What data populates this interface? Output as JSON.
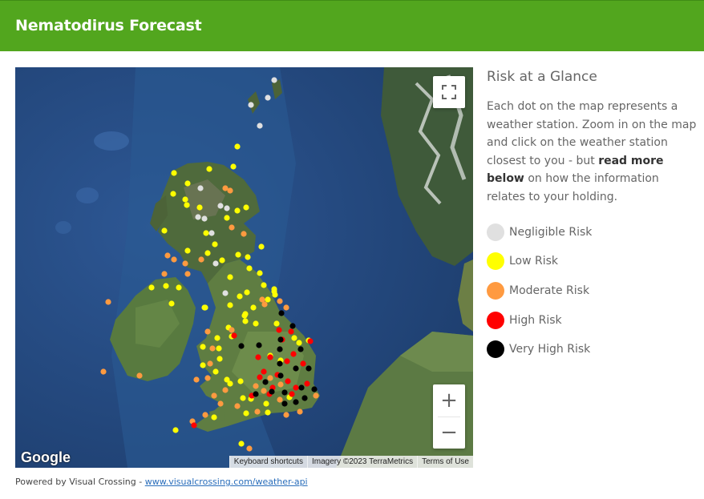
{
  "header": {
    "title": "Nematodirus Forecast"
  },
  "map": {
    "fullscreen_icon": "fullscreen-icon",
    "zoom_in_label": "+",
    "zoom_out_label": "−",
    "logo_text": "Google",
    "attribution": {
      "shortcuts": "Keyboard shortcuts",
      "imagery": "Imagery ©2023 TerraMetrics",
      "terms": "Terms of Use"
    },
    "colors": {
      "negligible": "#e0e0e0",
      "low": "#ffff00",
      "moderate": "#ff9a40",
      "high": "#ff0000",
      "very_high": "#000000"
    }
  },
  "sidebar": {
    "title": "Risk at a Glance",
    "description_before": "Each dot on the map represents a weather station. Zoom in on the map and click on the weather station closest to you - but ",
    "description_bold": "read more below",
    "description_after": " on how the information relates to your holding.",
    "legend": [
      {
        "label": "Negligible Risk",
        "color": "#e0e0e0"
      },
      {
        "label": "Low Risk",
        "color": "#ffff00"
      },
      {
        "label": "Moderate Risk",
        "color": "#ff9a40"
      },
      {
        "label": "High Risk",
        "color": "#ff0000"
      },
      {
        "label": "Very High Risk",
        "color": "#000000"
      }
    ]
  },
  "footer": {
    "prefix": "Powered by Visual Crossing - ",
    "link_text": "www.visualcrossing.com/weather-api"
  }
}
